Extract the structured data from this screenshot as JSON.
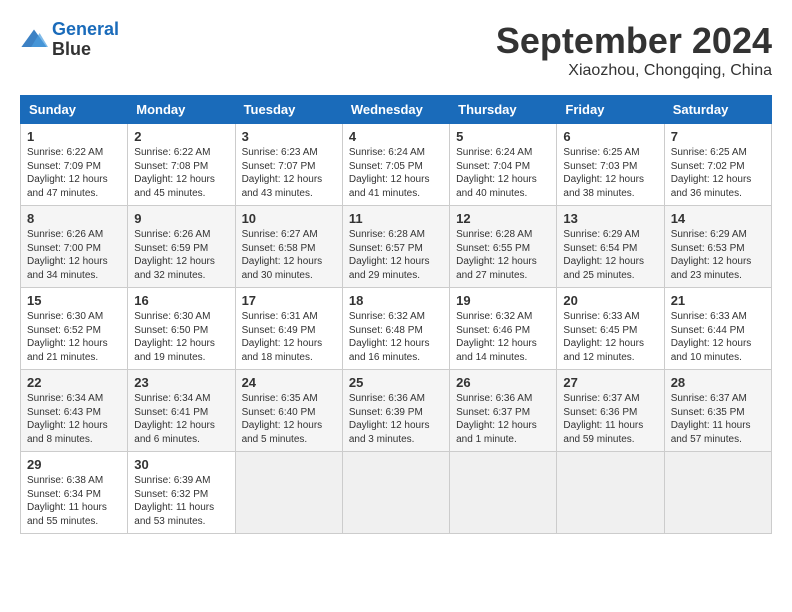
{
  "header": {
    "logo_line1": "General",
    "logo_line2": "Blue",
    "month": "September 2024",
    "location": "Xiaozhou, Chongqing, China"
  },
  "days_of_week": [
    "Sunday",
    "Monday",
    "Tuesday",
    "Wednesday",
    "Thursday",
    "Friday",
    "Saturday"
  ],
  "weeks": [
    [
      {
        "day": "1",
        "sunrise": "6:22 AM",
        "sunset": "7:09 PM",
        "daylight": "12 hours and 47 minutes."
      },
      {
        "day": "2",
        "sunrise": "6:22 AM",
        "sunset": "7:08 PM",
        "daylight": "12 hours and 45 minutes."
      },
      {
        "day": "3",
        "sunrise": "6:23 AM",
        "sunset": "7:07 PM",
        "daylight": "12 hours and 43 minutes."
      },
      {
        "day": "4",
        "sunrise": "6:24 AM",
        "sunset": "7:05 PM",
        "daylight": "12 hours and 41 minutes."
      },
      {
        "day": "5",
        "sunrise": "6:24 AM",
        "sunset": "7:04 PM",
        "daylight": "12 hours and 40 minutes."
      },
      {
        "day": "6",
        "sunrise": "6:25 AM",
        "sunset": "7:03 PM",
        "daylight": "12 hours and 38 minutes."
      },
      {
        "day": "7",
        "sunrise": "6:25 AM",
        "sunset": "7:02 PM",
        "daylight": "12 hours and 36 minutes."
      }
    ],
    [
      {
        "day": "8",
        "sunrise": "6:26 AM",
        "sunset": "7:00 PM",
        "daylight": "12 hours and 34 minutes."
      },
      {
        "day": "9",
        "sunrise": "6:26 AM",
        "sunset": "6:59 PM",
        "daylight": "12 hours and 32 minutes."
      },
      {
        "day": "10",
        "sunrise": "6:27 AM",
        "sunset": "6:58 PM",
        "daylight": "12 hours and 30 minutes."
      },
      {
        "day": "11",
        "sunrise": "6:28 AM",
        "sunset": "6:57 PM",
        "daylight": "12 hours and 29 minutes."
      },
      {
        "day": "12",
        "sunrise": "6:28 AM",
        "sunset": "6:55 PM",
        "daylight": "12 hours and 27 minutes."
      },
      {
        "day": "13",
        "sunrise": "6:29 AM",
        "sunset": "6:54 PM",
        "daylight": "12 hours and 25 minutes."
      },
      {
        "day": "14",
        "sunrise": "6:29 AM",
        "sunset": "6:53 PM",
        "daylight": "12 hours and 23 minutes."
      }
    ],
    [
      {
        "day": "15",
        "sunrise": "6:30 AM",
        "sunset": "6:52 PM",
        "daylight": "12 hours and 21 minutes."
      },
      {
        "day": "16",
        "sunrise": "6:30 AM",
        "sunset": "6:50 PM",
        "daylight": "12 hours and 19 minutes."
      },
      {
        "day": "17",
        "sunrise": "6:31 AM",
        "sunset": "6:49 PM",
        "daylight": "12 hours and 18 minutes."
      },
      {
        "day": "18",
        "sunrise": "6:32 AM",
        "sunset": "6:48 PM",
        "daylight": "12 hours and 16 minutes."
      },
      {
        "day": "19",
        "sunrise": "6:32 AM",
        "sunset": "6:46 PM",
        "daylight": "12 hours and 14 minutes."
      },
      {
        "day": "20",
        "sunrise": "6:33 AM",
        "sunset": "6:45 PM",
        "daylight": "12 hours and 12 minutes."
      },
      {
        "day": "21",
        "sunrise": "6:33 AM",
        "sunset": "6:44 PM",
        "daylight": "12 hours and 10 minutes."
      }
    ],
    [
      {
        "day": "22",
        "sunrise": "6:34 AM",
        "sunset": "6:43 PM",
        "daylight": "12 hours and 8 minutes."
      },
      {
        "day": "23",
        "sunrise": "6:34 AM",
        "sunset": "6:41 PM",
        "daylight": "12 hours and 6 minutes."
      },
      {
        "day": "24",
        "sunrise": "6:35 AM",
        "sunset": "6:40 PM",
        "daylight": "12 hours and 5 minutes."
      },
      {
        "day": "25",
        "sunrise": "6:36 AM",
        "sunset": "6:39 PM",
        "daylight": "12 hours and 3 minutes."
      },
      {
        "day": "26",
        "sunrise": "6:36 AM",
        "sunset": "6:37 PM",
        "daylight": "12 hours and 1 minute."
      },
      {
        "day": "27",
        "sunrise": "6:37 AM",
        "sunset": "6:36 PM",
        "daylight": "11 hours and 59 minutes."
      },
      {
        "day": "28",
        "sunrise": "6:37 AM",
        "sunset": "6:35 PM",
        "daylight": "11 hours and 57 minutes."
      }
    ],
    [
      {
        "day": "29",
        "sunrise": "6:38 AM",
        "sunset": "6:34 PM",
        "daylight": "11 hours and 55 minutes."
      },
      {
        "day": "30",
        "sunrise": "6:39 AM",
        "sunset": "6:32 PM",
        "daylight": "11 hours and 53 minutes."
      },
      null,
      null,
      null,
      null,
      null
    ]
  ]
}
